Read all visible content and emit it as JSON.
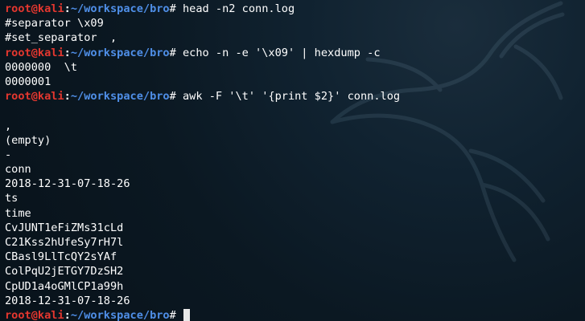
{
  "prompt": {
    "user_host": "root@kali",
    "separator": ":",
    "path": "~/workspace/bro",
    "symbol": "#"
  },
  "lines": [
    {
      "type": "prompt",
      "command": " head -n2 conn.log"
    },
    {
      "type": "output",
      "text": "#separator \\x09"
    },
    {
      "type": "output",
      "text": "#set_separator  ,"
    },
    {
      "type": "prompt",
      "command": " echo -n -e '\\x09' | hexdump -c"
    },
    {
      "type": "output",
      "text": "0000000  \\t"
    },
    {
      "type": "output",
      "text": "0000001"
    },
    {
      "type": "prompt",
      "command": " awk -F '\\t' '{print $2}' conn.log"
    },
    {
      "type": "output",
      "text": ""
    },
    {
      "type": "output",
      "text": ","
    },
    {
      "type": "output",
      "text": "(empty)"
    },
    {
      "type": "output",
      "text": "-"
    },
    {
      "type": "output",
      "text": "conn"
    },
    {
      "type": "output",
      "text": "2018-12-31-07-18-26"
    },
    {
      "type": "output",
      "text": "ts"
    },
    {
      "type": "output",
      "text": "time"
    },
    {
      "type": "output",
      "text": "CvJUNT1eFiZMs31cLd"
    },
    {
      "type": "output",
      "text": "C21Kss2hUfeSy7rH7l"
    },
    {
      "type": "output",
      "text": "CBasl9LlTcQY2sYAf"
    },
    {
      "type": "output",
      "text": "ColPqU2jETGY7DzSH2"
    },
    {
      "type": "output",
      "text": "CpUD1a4oGMlCP1a99h"
    },
    {
      "type": "output",
      "text": "2018-12-31-07-18-26"
    },
    {
      "type": "prompt",
      "command": " ",
      "cursor": true
    }
  ]
}
